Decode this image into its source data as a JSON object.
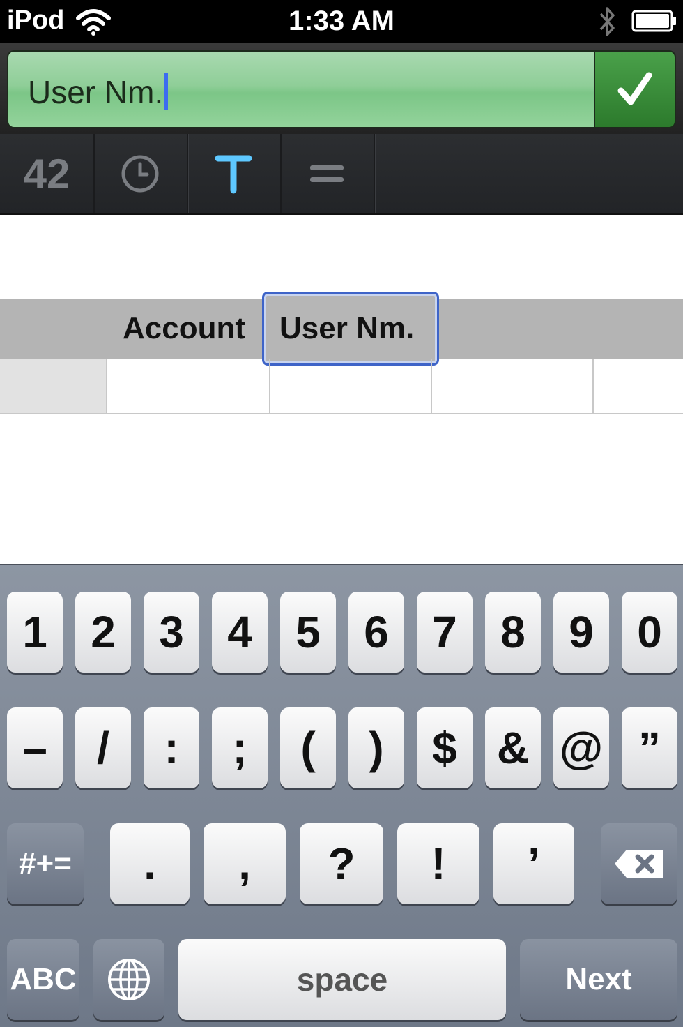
{
  "status_bar": {
    "carrier": "iPod",
    "time": "1:33 AM"
  },
  "input": {
    "value": "User Nm."
  },
  "toolbar": {
    "number_tool": "42"
  },
  "sheet": {
    "columns": [
      "Account",
      "User Nm."
    ]
  },
  "keyboard": {
    "row1": [
      "1",
      "2",
      "3",
      "4",
      "5",
      "6",
      "7",
      "8",
      "9",
      "0"
    ],
    "row2": [
      "–",
      "/",
      ":",
      ";",
      "(",
      ")",
      "$",
      "&",
      "@",
      "”"
    ],
    "row3": [
      "#+=",
      ".",
      ",",
      "?",
      "!",
      "’"
    ],
    "abc": "ABC",
    "space": "space",
    "next": "Next"
  },
  "colors": {
    "input_green": "#8fce98",
    "confirm_green": "#3a8e3a",
    "selection_blue": "#3e64c8",
    "text_tool_blue": "#5ec8ff"
  }
}
